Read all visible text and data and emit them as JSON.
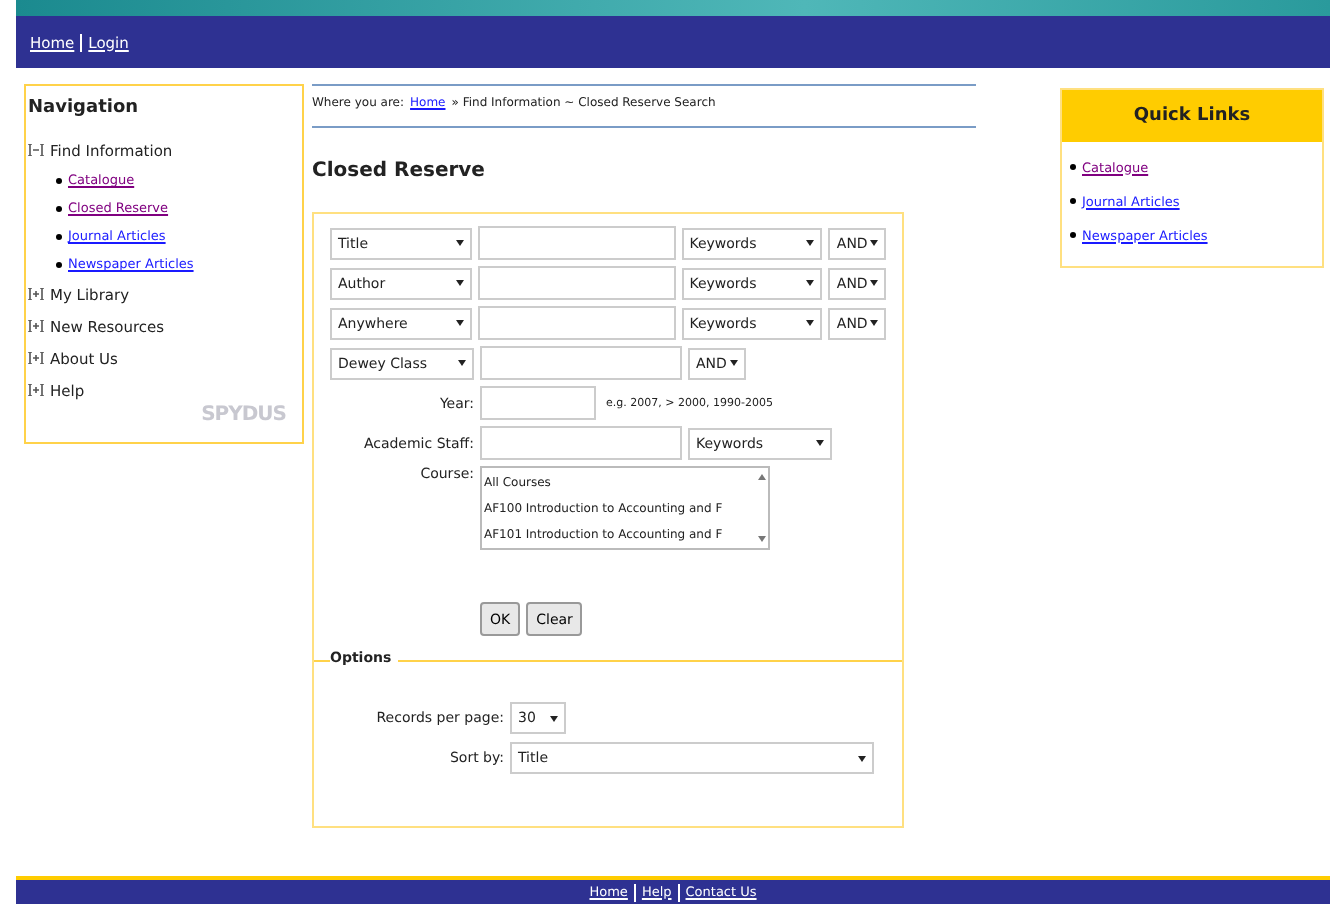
{
  "top_links": [
    "Home",
    "Login"
  ],
  "navigation": {
    "title": "Navigation",
    "items": [
      {
        "label": "Find Information",
        "expanded": true,
        "children": [
          {
            "label": "Catalogue",
            "visited": true
          },
          {
            "label": "Closed Reserve",
            "visited": true
          },
          {
            "label": "Journal Articles",
            "visited": false
          },
          {
            "label": "Newspaper Articles",
            "visited": false
          }
        ]
      },
      {
        "label": "My Library",
        "expanded": false
      },
      {
        "label": "New Resources",
        "expanded": false
      },
      {
        "label": "About Us",
        "expanded": false
      },
      {
        "label": "Help",
        "expanded": false
      }
    ],
    "logo": "SPYDUS"
  },
  "breadcrumb": {
    "prefix": "Where you are:",
    "link": "Home",
    "rest": "» Find Information ~ Closed Reserve Search"
  },
  "heading": "Closed Reserve",
  "search_rows": [
    {
      "field": "Title",
      "match": "Keywords",
      "operator": "AND"
    },
    {
      "field": "Author",
      "match": "Keywords",
      "operator": "AND"
    },
    {
      "field": "Anywhere",
      "match": "Keywords",
      "operator": "AND"
    },
    {
      "field": "Dewey Class",
      "operator": "AND"
    }
  ],
  "year": {
    "label": "Year:",
    "hint": "e.g. 2007, > 2000, 1990-2005"
  },
  "academic_staff": {
    "label": "Academic Staff:",
    "match": "Keywords"
  },
  "course": {
    "label": "Course:",
    "options": [
      "All Courses",
      "AF100 Introduction to Accounting and F",
      "AF101 Introduction to Accounting and F"
    ]
  },
  "buttons": [
    "OK",
    "Clear"
  ],
  "options": {
    "title": "Options",
    "records_label": "Records per page:",
    "records_value": "30",
    "sort_label": "Sort by:",
    "sort_value": "Title"
  },
  "quick_links": {
    "title": "Quick Links",
    "items": [
      {
        "label": "Catalogue",
        "visited": true
      },
      {
        "label": "Journal Articles",
        "visited": false
      },
      {
        "label": "Newspaper Articles",
        "visited": false
      }
    ]
  },
  "footer_links": [
    "Home",
    "Help",
    "Contact Us"
  ]
}
